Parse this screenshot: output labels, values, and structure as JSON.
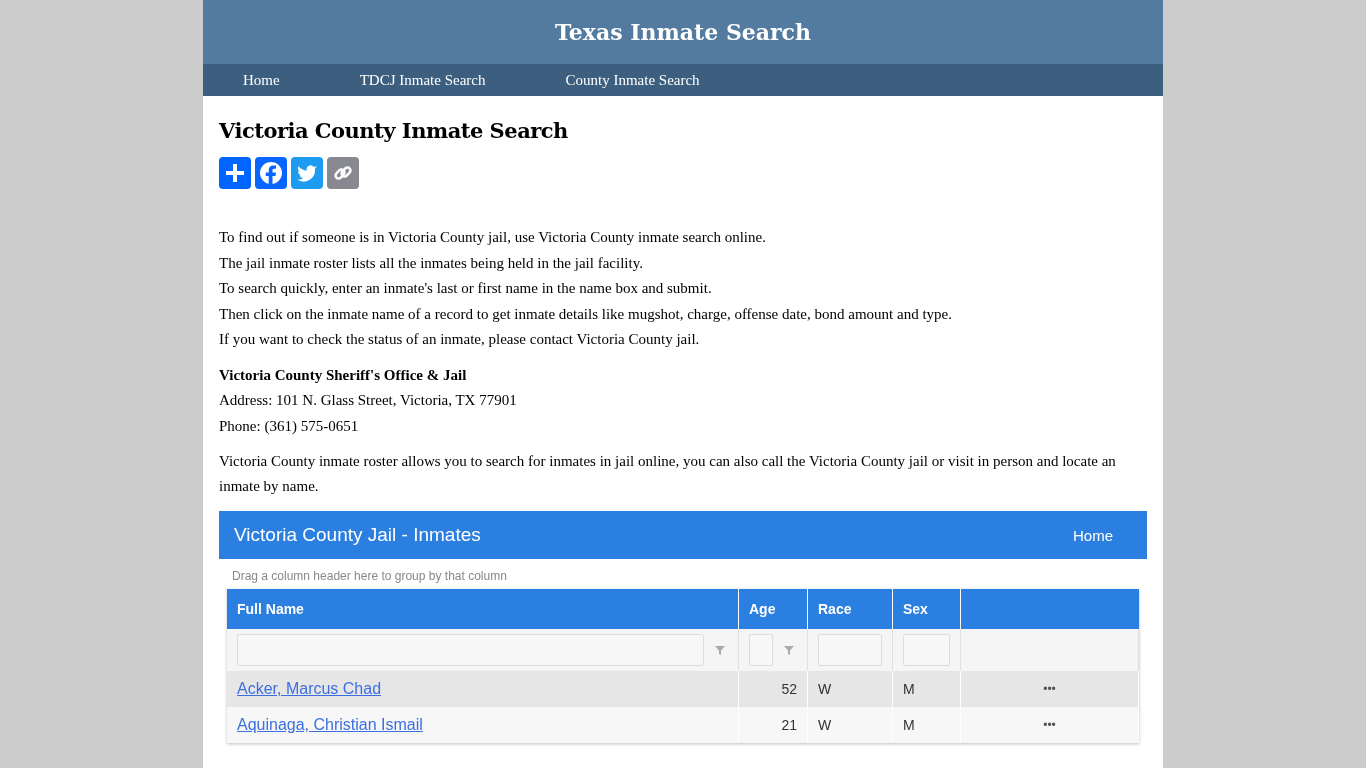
{
  "site_title": "Texas Inmate Search",
  "nav": [
    {
      "label": "Home"
    },
    {
      "label": "TDCJ Inmate Search"
    },
    {
      "label": "County Inmate Search"
    }
  ],
  "heading": "Victoria County Inmate Search",
  "share_buttons": [
    {
      "kind": "share"
    },
    {
      "kind": "facebook"
    },
    {
      "kind": "twitter"
    },
    {
      "kind": "link"
    }
  ],
  "intro_lines": [
    "To find out if someone is in Victoria County jail, use Victoria County inmate search online.",
    "The jail inmate roster lists all the inmates being held in the jail facility.",
    "To search quickly, enter an inmate's last or first name in the name box and submit.",
    "Then click on the inmate name of a record to get inmate details like mugshot, charge, offense date, bond amount and type.",
    "If you want to check the status of an inmate, please contact Victoria County jail."
  ],
  "office": {
    "name": "Victoria County Sheriff's Office & Jail",
    "address": "Address: 101 N. Glass Street, Victoria, TX 77901",
    "phone": "Phone: (361) 575-0651"
  },
  "closing": "Victoria County inmate roster allows you to search for inmates in jail online, you can also call the Victoria County jail or visit in person and locate an inmate by name.",
  "roster": {
    "title": "Victoria County Jail - Inmates",
    "home_link": "Home",
    "group_hint": "Drag a column header here to group by that column",
    "columns": [
      "Full Name",
      "Age",
      "Race",
      "Sex"
    ],
    "rows": [
      {
        "name": "Acker, Marcus Chad",
        "age": "52",
        "race": "W",
        "sex": "M",
        "menu": "•••"
      },
      {
        "name": "Aquinaga, Christian Ismail",
        "age": "21",
        "race": "W",
        "sex": "M",
        "menu": "•••"
      }
    ]
  }
}
